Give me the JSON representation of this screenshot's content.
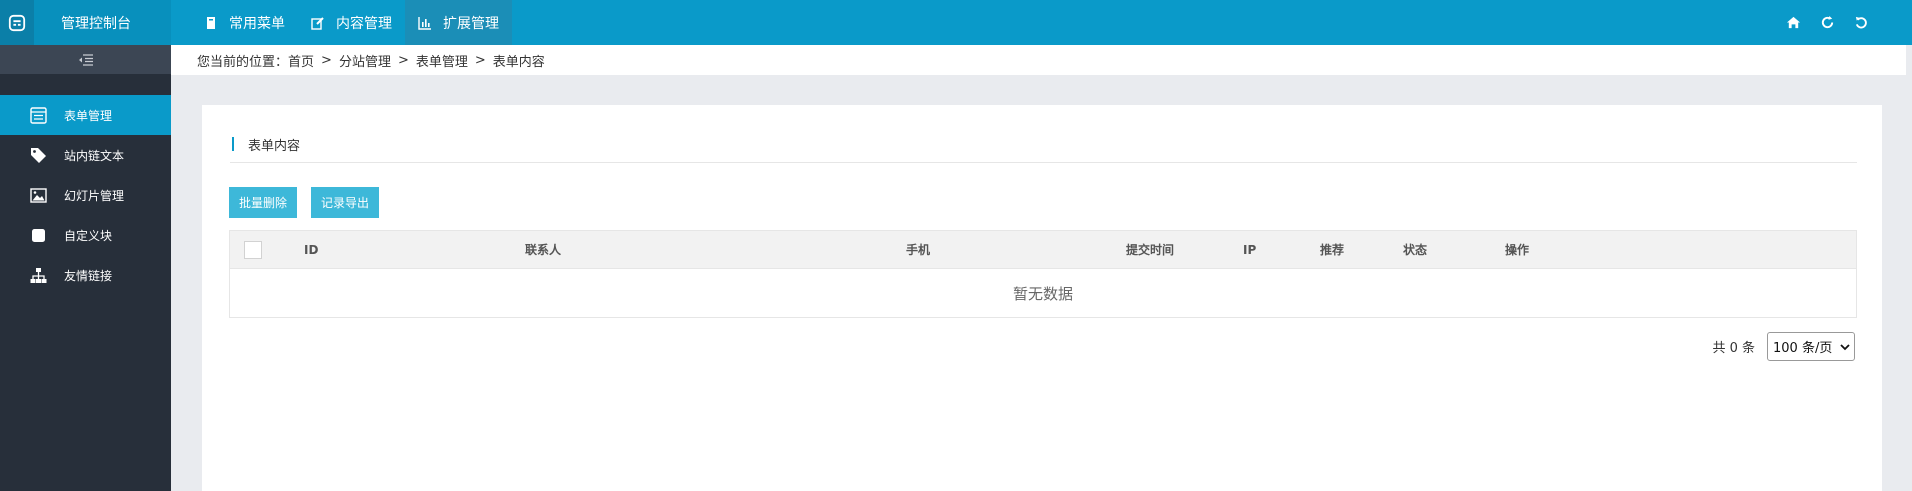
{
  "brand": {
    "title": "管理控制台",
    "logo_icon": "app-logo-icon"
  },
  "topnav": [
    {
      "label": "常用菜单",
      "icon": "bookmark-icon",
      "active": false
    },
    {
      "label": "内容管理",
      "icon": "edit-icon",
      "active": false
    },
    {
      "label": "扩展管理",
      "icon": "bar-chart-icon",
      "active": true
    }
  ],
  "topright": [
    {
      "icon": "home-icon"
    },
    {
      "icon": "refresh-icon"
    },
    {
      "icon": "undo-icon"
    }
  ],
  "sidebar": {
    "toggle_icon": "menu-collapse-icon",
    "items": [
      {
        "label": "表单管理",
        "icon": "form-icon",
        "active": true
      },
      {
        "label": "站内链文本",
        "icon": "tag-icon",
        "active": false
      },
      {
        "label": "幻灯片管理",
        "icon": "image-icon",
        "active": false
      },
      {
        "label": "自定义块",
        "icon": "block-icon",
        "active": false
      },
      {
        "label": "友情链接",
        "icon": "sitemap-icon",
        "active": false
      }
    ]
  },
  "breadcrumb": {
    "prefix": "您当前的位置：",
    "items": [
      "首页",
      "分站管理",
      "表单管理",
      "表单内容"
    ],
    "separator": ">"
  },
  "card": {
    "title": "表单内容",
    "buttons": {
      "batch_delete": "批量删除",
      "export": "记录导出"
    },
    "table": {
      "columns": [
        "ID",
        "联系人",
        "手机",
        "提交时间",
        "IP",
        "推荐",
        "状态",
        "操作"
      ],
      "empty_text": "暂无数据"
    },
    "pager": {
      "total_text": "共 0 条",
      "page_size": "100 条/页"
    }
  },
  "colors": {
    "primary": "#0a9ac9",
    "sidebar": "#272f3a",
    "button": "#3db8d9"
  }
}
